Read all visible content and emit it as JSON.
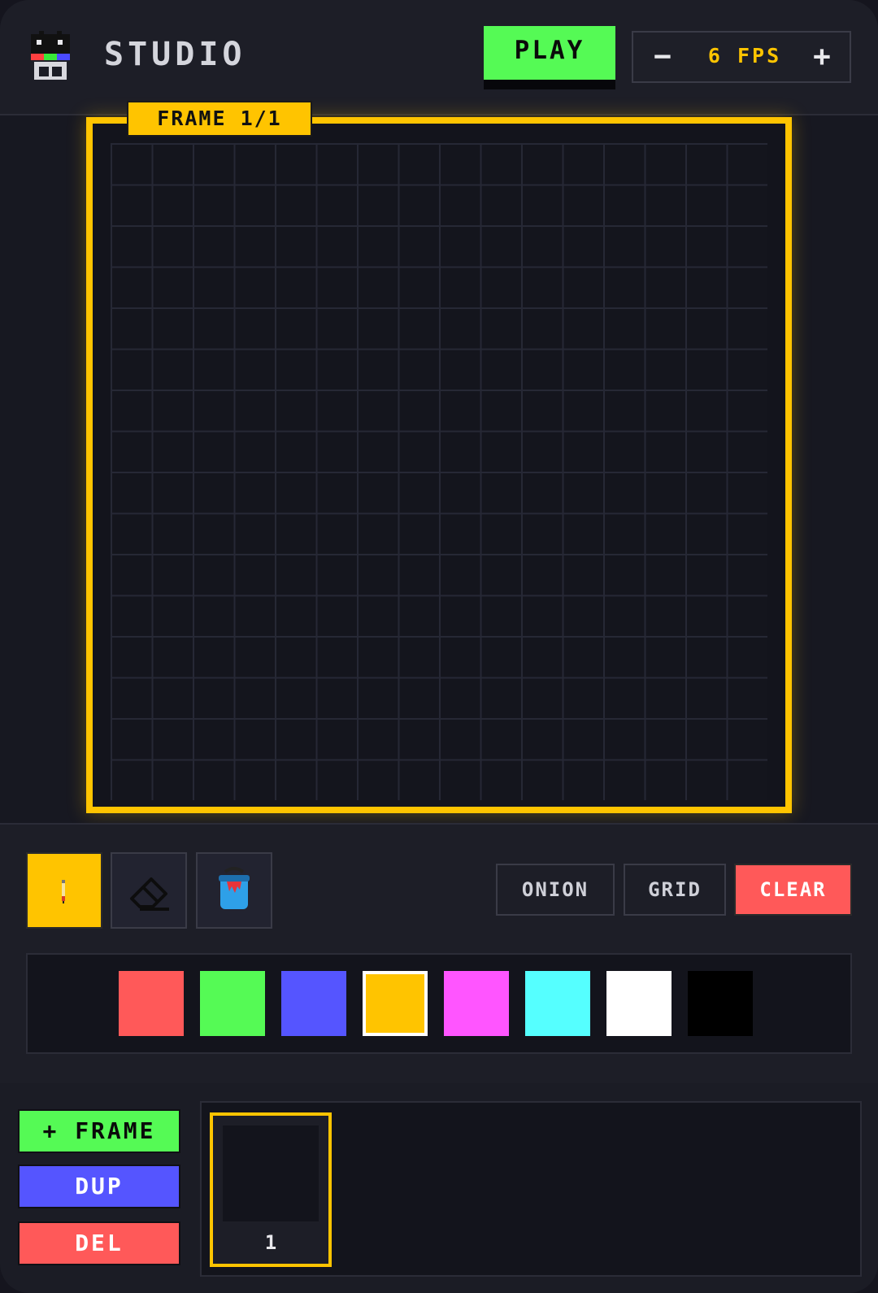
{
  "header": {
    "title": "STUDIO",
    "play_label": "PLAY",
    "fps": {
      "minus": "−",
      "plus": "+",
      "value_text": "6 FPS"
    }
  },
  "canvas": {
    "frame_label": "FRAME 1/1",
    "grid_columns": 16,
    "grid_rows": 16
  },
  "tools": [
    {
      "name": "pencil",
      "icon": "pencil-icon",
      "active": true
    },
    {
      "name": "eraser",
      "icon": "eraser-icon",
      "active": false
    },
    {
      "name": "fill",
      "icon": "paint-bucket-icon",
      "active": false
    }
  ],
  "options": {
    "onion": "ONION",
    "grid": "GRID",
    "clear": "CLEAR"
  },
  "palette": {
    "colors": [
      "#ff5959",
      "#55fa55",
      "#5555ff",
      "#ffc400",
      "#ff55ff",
      "#55ffff",
      "#ffffff",
      "#000000"
    ],
    "selected_color": "#ffc400"
  },
  "timeline": {
    "add_frame": "+ FRAME",
    "dup": "DUP",
    "del": "DEL",
    "frames": [
      {
        "number": "1",
        "selected": true
      }
    ]
  },
  "theme": {
    "accent": "#ffc400",
    "green": "#55fa55",
    "red": "#ff5959",
    "blue": "#5555ff"
  }
}
